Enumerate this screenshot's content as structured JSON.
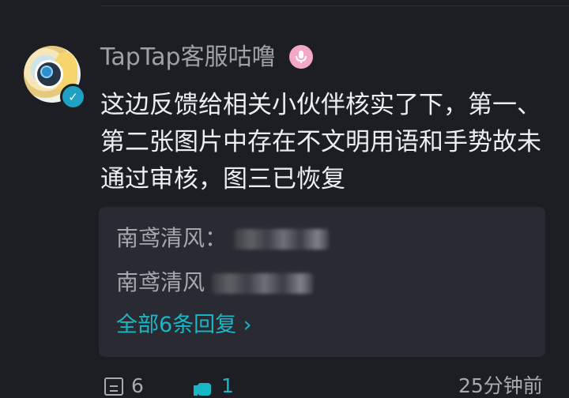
{
  "comment": {
    "author": "TapTap客服咕噜",
    "text": "这边反馈给相关小伙伴核实了下，第一、第二张图片中存在不文明用语和手势故未通过审核，图三已恢复"
  },
  "replies": {
    "items": [
      {
        "author": "南鸢清风："
      },
      {
        "author": "南鸢清风"
      }
    ],
    "all_label": "全部6条回复 ›"
  },
  "footer": {
    "comment_count": "6",
    "like_count": "1",
    "time": "25分钟前"
  },
  "colors": {
    "background": "#1d1e24",
    "reply_background": "#2a2b32",
    "accent": "#18b7c7",
    "badge": "#f3a9c6"
  },
  "icons": [
    "comment-icon",
    "like-icon",
    "verified-icon",
    "microphone-icon"
  ]
}
